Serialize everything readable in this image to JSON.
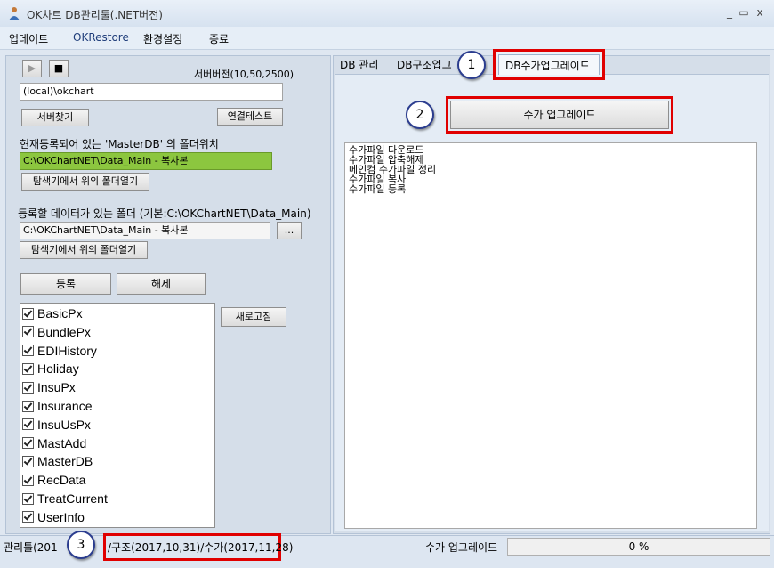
{
  "window": {
    "title": "OK차트 DB관리툴(.NET버전)",
    "minimize": "_",
    "maximize": "▭",
    "close": "x"
  },
  "menu": [
    "업데이트",
    "OKRestore",
    "환경설정",
    "종료"
  ],
  "left": {
    "play": "▶",
    "stop": "■",
    "server_version": "서버버전(10,50,2500)",
    "server_value": "(local)\\okchart",
    "find_server": "서버찾기",
    "test_connection": "연결테스트",
    "masterdb_label": "현재등록되어 있는 'MasterDB' 의 폴더위치",
    "masterdb_path": "C:\\OKChartNET\\Data_Main - 복사본",
    "open_explorer1": "탐색기에서 위의 폴더열기",
    "data_folder_label": "등록할 데이터가 있는 폴더 (기본:C:\\OKChartNET\\Data_Main)",
    "data_folder_path": "C:\\OKChartNET\\Data_Main - 복사본",
    "browse": "...",
    "open_explorer2": "탐색기에서 위의 폴더열기",
    "register": "등록",
    "unregister": "해제",
    "refresh": "새로고침",
    "db_items": [
      "BasicPx",
      "BundlePx",
      "EDIHistory",
      "Holiday",
      "InsuPx",
      "Insurance",
      "InsuUsPx",
      "MastAdd",
      "MasterDB",
      "RecData",
      "TreatCurrent",
      "UserInfo"
    ]
  },
  "right": {
    "tabs": [
      "DB 관리",
      "DB구조업그",
      "DB수가업그레이드"
    ],
    "upgrade_button": "수가 업그레이드",
    "log_lines": [
      "수가파일 다운로드",
      "수가파일 압축해제",
      "메인컴 수가파일 정리",
      "수가파일 복사",
      "수가파일 등록"
    ]
  },
  "callouts": [
    "1",
    "2",
    "3"
  ],
  "status": {
    "left_a": "관리툴(201",
    "left_b": "/구조(2017,10,31)/수가(2017,11,28)",
    "task": "수가 업그레이드",
    "progress_label": "0 %",
    "progress": 0
  },
  "colors": {
    "masterdb_highlight": "#8cc63f",
    "annotation_red": "#e00000",
    "callout_border": "#2b3d8f"
  }
}
